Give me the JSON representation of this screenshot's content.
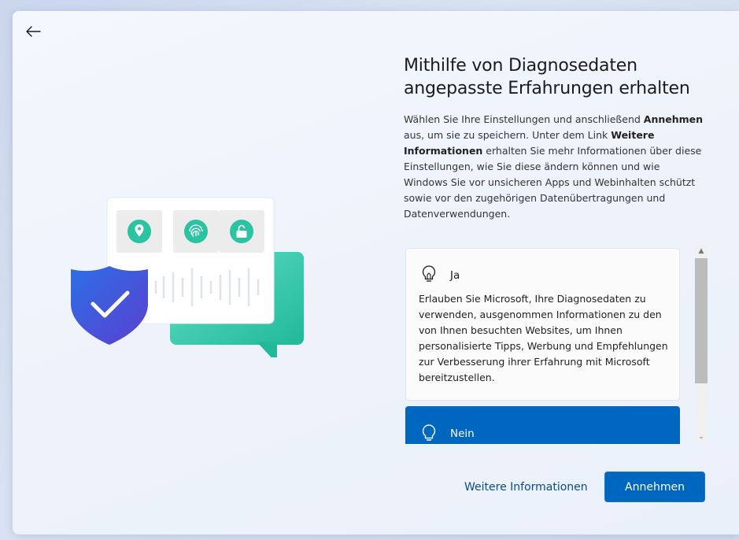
{
  "window": {
    "title": "Mithilfe von Diagnosedaten angepasste Erfahrungen erhalten",
    "title_line1": "Mithilfe von Diagnosedaten",
    "title_line2": "angepasste Erfahrungen erhalten"
  },
  "description": {
    "part1": "Wählen Sie Ihre Einstellungen und anschließend ",
    "bold1": "Annehmen",
    "part2": " aus, um sie zu speichern. Unter dem Link ",
    "bold2": "Weitere Informationen",
    "part3": " erhalten Sie mehr Informationen über diese Einstellungen, wie Sie diese ändern können und wie Windows Sie vor unsicheren Apps und Webinhalten schützt sowie vor den zugehörigen Datenübertragungen und Datenverwendungen."
  },
  "options": [
    {
      "label": "Ja",
      "icon": "lightbulb-icon",
      "description": "Erlauben Sie Microsoft, Ihre Diagnosedaten zu verwenden, ausgenommen Informationen zu den von Ihnen besuchten Websites, um Ihnen personalisierte Tipps, Werbung und Empfehlungen zur Verbesserung ihrer Erfahrung mit Microsoft bereitzustellen.",
      "selected": false
    },
    {
      "label": "Nein",
      "icon": "lightbulb-icon",
      "selected": true
    }
  ],
  "footer": {
    "link_label": "Weitere Informationen",
    "accept_label": "Annehmen"
  },
  "colors": {
    "accent": "#0067c0",
    "link": "#0a4b8f",
    "shield": "#3b5fd9",
    "chat_bubble": "#3fcfb4"
  }
}
